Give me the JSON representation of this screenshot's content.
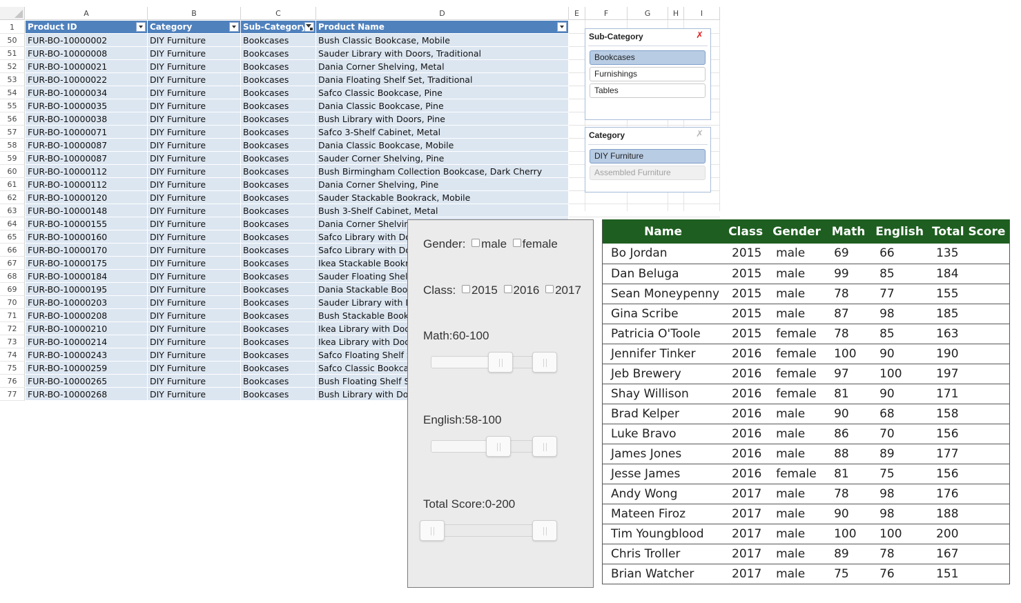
{
  "spreadsheet": {
    "columns": [
      "A",
      "B",
      "C",
      "D",
      "E",
      "F",
      "G",
      "H",
      "I"
    ],
    "header_row_number": "1",
    "headers": [
      "Product ID",
      "Category",
      "Sub-Category",
      "Product Name"
    ],
    "rows": [
      {
        "num": "50",
        "id": "FUR-BO-10000002",
        "category": "DIY Furniture",
        "sub": "Bookcases",
        "name": "Bush Classic Bookcase, Mobile"
      },
      {
        "num": "51",
        "id": "FUR-BO-10000008",
        "category": "DIY Furniture",
        "sub": "Bookcases",
        "name": "Sauder Library with Doors, Traditional"
      },
      {
        "num": "52",
        "id": "FUR-BO-10000021",
        "category": "DIY Furniture",
        "sub": "Bookcases",
        "name": "Dania Corner Shelving, Metal"
      },
      {
        "num": "53",
        "id": "FUR-BO-10000022",
        "category": "DIY Furniture",
        "sub": "Bookcases",
        "name": "Dania Floating Shelf Set, Traditional"
      },
      {
        "num": "54",
        "id": "FUR-BO-10000034",
        "category": "DIY Furniture",
        "sub": "Bookcases",
        "name": "Safco Classic Bookcase, Pine"
      },
      {
        "num": "55",
        "id": "FUR-BO-10000035",
        "category": "DIY Furniture",
        "sub": "Bookcases",
        "name": "Dania Classic Bookcase, Pine"
      },
      {
        "num": "56",
        "id": "FUR-BO-10000038",
        "category": "DIY Furniture",
        "sub": "Bookcases",
        "name": "Bush Library with Doors, Pine"
      },
      {
        "num": "57",
        "id": "FUR-BO-10000071",
        "category": "DIY Furniture",
        "sub": "Bookcases",
        "name": "Safco 3-Shelf Cabinet, Metal"
      },
      {
        "num": "58",
        "id": "FUR-BO-10000087",
        "category": "DIY Furniture",
        "sub": "Bookcases",
        "name": "Dania Classic Bookcase, Mobile"
      },
      {
        "num": "59",
        "id": "FUR-BO-10000087",
        "category": "DIY Furniture",
        "sub": "Bookcases",
        "name": "Sauder Corner Shelving, Pine"
      },
      {
        "num": "60",
        "id": "FUR-BO-10000112",
        "category": "DIY Furniture",
        "sub": "Bookcases",
        "name": "Bush Birmingham Collection Bookcase, Dark Cherry"
      },
      {
        "num": "61",
        "id": "FUR-BO-10000112",
        "category": "DIY Furniture",
        "sub": "Bookcases",
        "name": "Dania Corner Shelving, Pine"
      },
      {
        "num": "62",
        "id": "FUR-BO-10000120",
        "category": "DIY Furniture",
        "sub": "Bookcases",
        "name": "Sauder Stackable Bookrack, Mobile"
      },
      {
        "num": "63",
        "id": "FUR-BO-10000148",
        "category": "DIY Furniture",
        "sub": "Bookcases",
        "name": "Bush 3-Shelf Cabinet, Metal"
      },
      {
        "num": "64",
        "id": "FUR-BO-10000155",
        "category": "DIY Furniture",
        "sub": "Bookcases",
        "name": "Dania Corner Shelving"
      },
      {
        "num": "65",
        "id": "FUR-BO-10000160",
        "category": "DIY Furniture",
        "sub": "Bookcases",
        "name": "Safco Library with Doors"
      },
      {
        "num": "66",
        "id": "FUR-BO-10000170",
        "category": "DIY Furniture",
        "sub": "Bookcases",
        "name": "Safco Library with Doors"
      },
      {
        "num": "67",
        "id": "FUR-BO-10000175",
        "category": "DIY Furniture",
        "sub": "Bookcases",
        "name": "Ikea Stackable Bookrack"
      },
      {
        "num": "68",
        "id": "FUR-BO-10000184",
        "category": "DIY Furniture",
        "sub": "Bookcases",
        "name": "Sauder Floating Shelf Set"
      },
      {
        "num": "69",
        "id": "FUR-BO-10000195",
        "category": "DIY Furniture",
        "sub": "Bookcases",
        "name": "Dania Stackable Bookrack"
      },
      {
        "num": "70",
        "id": "FUR-BO-10000203",
        "category": "DIY Furniture",
        "sub": "Bookcases",
        "name": "Sauder Library with Doors"
      },
      {
        "num": "71",
        "id": "FUR-BO-10000208",
        "category": "DIY Furniture",
        "sub": "Bookcases",
        "name": "Bush Stackable Bookrack"
      },
      {
        "num": "72",
        "id": "FUR-BO-10000210",
        "category": "DIY Furniture",
        "sub": "Bookcases",
        "name": "Ikea Library with Doors"
      },
      {
        "num": "73",
        "id": "FUR-BO-10000214",
        "category": "DIY Furniture",
        "sub": "Bookcases",
        "name": "Ikea Library with Doors"
      },
      {
        "num": "74",
        "id": "FUR-BO-10000243",
        "category": "DIY Furniture",
        "sub": "Bookcases",
        "name": "Safco Floating Shelf Set"
      },
      {
        "num": "75",
        "id": "FUR-BO-10000259",
        "category": "DIY Furniture",
        "sub": "Bookcases",
        "name": "Safco Classic Bookcase"
      },
      {
        "num": "76",
        "id": "FUR-BO-10000265",
        "category": "DIY Furniture",
        "sub": "Bookcases",
        "name": "Bush Floating Shelf Set"
      },
      {
        "num": "77",
        "id": "FUR-BO-10000268",
        "category": "DIY Furniture",
        "sub": "Bookcases",
        "name": "Bush Library with Doors"
      }
    ]
  },
  "slicers": {
    "subcategory": {
      "title": "Sub-Category",
      "clear_icon": "clear-filter-icon",
      "items": [
        {
          "label": "Bookcases",
          "selected": true
        },
        {
          "label": "Furnishings",
          "selected": false
        },
        {
          "label": "Tables",
          "selected": false
        }
      ]
    },
    "category": {
      "title": "Category",
      "clear_icon": "clear-filter-icon",
      "items": [
        {
          "label": "DIY Furniture",
          "selected": true
        },
        {
          "label": "Assembled Furniture",
          "selected": false
        }
      ]
    }
  },
  "filter_panel": {
    "gender_label": "Gender:",
    "gender_options": [
      "male",
      "female"
    ],
    "class_label": "Class:",
    "class_options": [
      "2015",
      "2016",
      "2017"
    ],
    "math_label": "Math:60-100",
    "math_range": [
      60,
      100
    ],
    "english_label": "English:58-100",
    "english_range": [
      58,
      100
    ],
    "total_label": "Total Score:0-200",
    "total_range": [
      0,
      200
    ]
  },
  "score_table": {
    "headers": [
      "Name",
      "Class",
      "Gender",
      "Math",
      "English",
      "Total Score"
    ],
    "header_color": "#1e5e20",
    "rows": [
      [
        "Bo Jordan",
        "2015",
        "male",
        "69",
        "66",
        "135"
      ],
      [
        "Dan Beluga",
        "2015",
        "male",
        "99",
        "85",
        "184"
      ],
      [
        "Sean Moneypenny",
        "2015",
        "male",
        "78",
        "77",
        "155"
      ],
      [
        "Gina Scribe",
        "2015",
        "male",
        "87",
        "98",
        "185"
      ],
      [
        "Patricia O'Toole",
        "2015",
        "female",
        "78",
        "85",
        "163"
      ],
      [
        "Jennifer Tinker",
        "2016",
        "female",
        "100",
        "90",
        "190"
      ],
      [
        "Jeb Brewery",
        "2016",
        "female",
        "97",
        "100",
        "197"
      ],
      [
        "Shay Willison",
        "2016",
        "female",
        "81",
        "90",
        "171"
      ],
      [
        "Brad Kelper",
        "2016",
        "male",
        "90",
        "68",
        "158"
      ],
      [
        "Luke Bravo",
        "2016",
        "male",
        "86",
        "70",
        "156"
      ],
      [
        "James Jones",
        "2016",
        "male",
        "88",
        "89",
        "177"
      ],
      [
        "Jesse James",
        "2016",
        "female",
        "81",
        "75",
        "156"
      ],
      [
        "Andy Wong",
        "2017",
        "male",
        "78",
        "98",
        "176"
      ],
      [
        "Mateen Firoz",
        "2017",
        "male",
        "90",
        "98",
        "188"
      ],
      [
        "Tim Youngblood",
        "2017",
        "male",
        "100",
        "100",
        "200"
      ],
      [
        "Chris Troller",
        "2017",
        "male",
        "89",
        "78",
        "167"
      ],
      [
        "Brian Watcher",
        "2017",
        "male",
        "75",
        "76",
        "151"
      ]
    ]
  }
}
